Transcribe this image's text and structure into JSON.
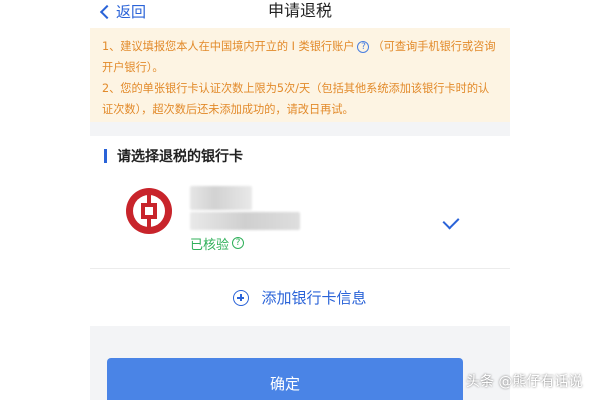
{
  "header": {
    "back_label": "返回",
    "title": "申请退税"
  },
  "notice": {
    "line1": "1、建议填报您本人在中国境内开立的 I 类银行账户",
    "line1_tail": "（可查询手机银行或咨询开户银行）。",
    "line2": "2、您的单张银行卡认证次数上限为5次/天（包括其他系统添加该银行卡时的认证次数），超次数后还未添加成功的，请改日再试。",
    "help_symbol": "?"
  },
  "card": {
    "section_title": "请选择退税的银行卡",
    "bank_logo_icon": "bank-of-china-logo-icon",
    "verified_label": "已核验",
    "help_symbol": "?",
    "add_card_label": "添加银行卡信息"
  },
  "confirm_label": "确定",
  "watermark": "头条 @熊仔有话说",
  "colors": {
    "accent": "#2a63d8",
    "notice_text": "#e28a2a",
    "verified": "#30b05a",
    "button": "#4a84e6"
  }
}
